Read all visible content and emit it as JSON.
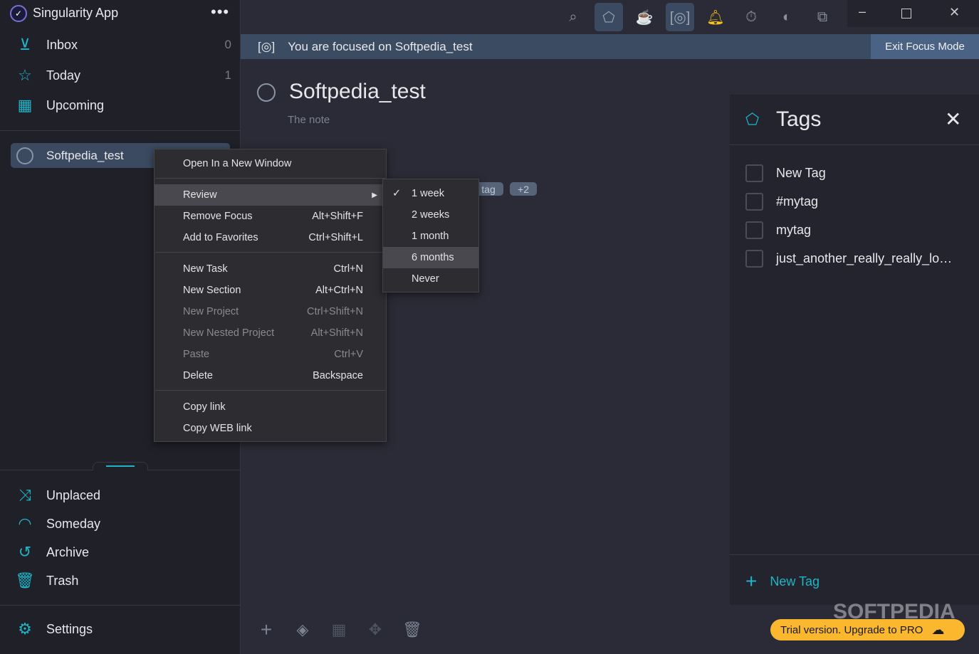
{
  "app": {
    "title": "Singularity App",
    "more_icon": "ellipsis-icon"
  },
  "sidebar": {
    "top_items": [
      {
        "label": "Inbox",
        "count": "0",
        "icon": "inbox-icon"
      },
      {
        "label": "Today",
        "count": "1",
        "icon": "star-icon"
      },
      {
        "label": "Upcoming",
        "count": "",
        "icon": "calendar-icon"
      }
    ],
    "project": "Softpedia_test",
    "bottom_items": [
      {
        "label": "Unplaced",
        "icon": "shuffle-icon"
      },
      {
        "label": "Someday",
        "icon": "rainbow-icon"
      },
      {
        "label": "Archive",
        "icon": "history-icon"
      },
      {
        "label": "Trash",
        "icon": "trash-icon"
      }
    ],
    "settings": "Settings"
  },
  "focus": {
    "message": "You are focused on Softpedia_test",
    "exit_label": "Exit Focus Mode"
  },
  "project": {
    "title": "Softpedia_test",
    "note": "The note",
    "tag_partial": "tag",
    "tag_more": "+2"
  },
  "context_menu": {
    "items": [
      {
        "label": "Open In a New Window",
        "shortcut": ""
      },
      {
        "label": "Review",
        "shortcut": ""
      },
      {
        "label": "Remove Focus",
        "shortcut": "Alt+Shift+F"
      },
      {
        "label": "Add to Favorites",
        "shortcut": "Ctrl+Shift+L"
      },
      {
        "label": "New Task",
        "shortcut": "Ctrl+N"
      },
      {
        "label": "New Section",
        "shortcut": "Alt+Ctrl+N"
      },
      {
        "label": "New Project",
        "shortcut": "Ctrl+Shift+N",
        "disabled": true
      },
      {
        "label": "New Nested Project",
        "shortcut": "Alt+Shift+N",
        "disabled": true
      },
      {
        "label": "Paste",
        "shortcut": "Ctrl+V",
        "disabled": true
      },
      {
        "label": "Delete",
        "shortcut": "Backspace"
      },
      {
        "label": "Copy link",
        "shortcut": ""
      },
      {
        "label": "Copy WEB link",
        "shortcut": ""
      }
    ],
    "review_submenu": [
      {
        "label": "1 week",
        "checked": true
      },
      {
        "label": "2 weeks"
      },
      {
        "label": "1 month"
      },
      {
        "label": "6 months",
        "hovered": true
      },
      {
        "label": "Never"
      }
    ]
  },
  "tags_panel": {
    "title": "Tags",
    "tags": [
      "New Tag",
      "#mytag",
      "mytag",
      "just_another_really_really_lo…"
    ],
    "new_tag_label": "New Tag"
  },
  "trial": {
    "label": "Trial version. Upgrade to PRO"
  },
  "watermark": "SOFTPEDIA",
  "colors": {
    "accent": "#1fb5c8",
    "trial": "#fbb82f",
    "bell": "#f5c518"
  }
}
